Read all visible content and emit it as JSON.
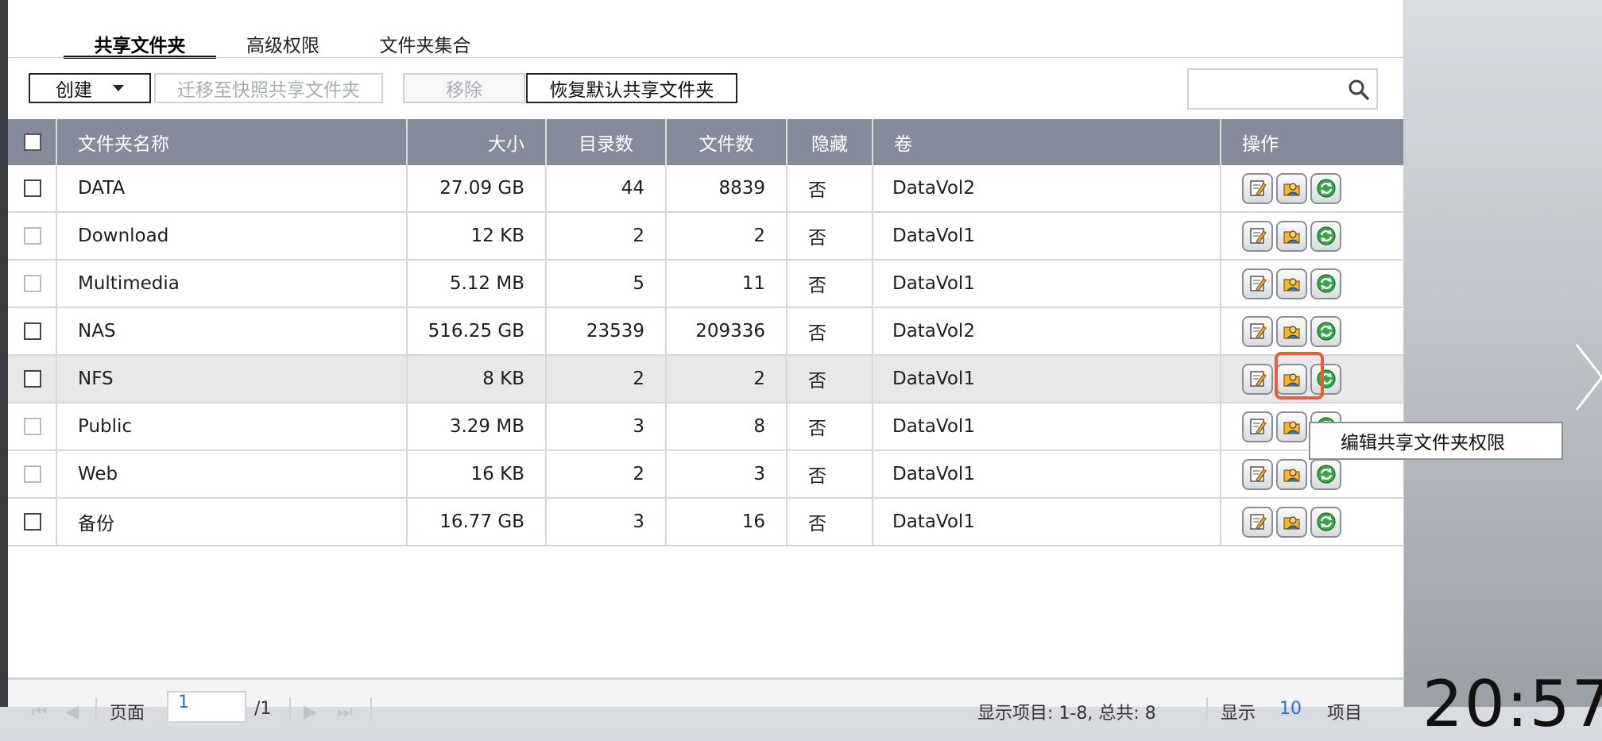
{
  "tabs": [
    {
      "label": "共享文件夹",
      "active": true
    },
    {
      "label": "高级权限",
      "active": false
    },
    {
      "label": "文件夹集合",
      "active": false
    }
  ],
  "toolbar": {
    "create": "创建",
    "migrate": "迁移至快照共享文件夹",
    "remove": "移除",
    "restore": "恢复默认共享文件夹"
  },
  "search": {
    "placeholder": ""
  },
  "table": {
    "headers": {
      "name": "文件夹名称",
      "size": "大小",
      "dirs": "目录数",
      "files": "文件数",
      "hidden": "隐藏",
      "volume": "卷",
      "actions": "操作"
    },
    "rows": [
      {
        "name": "DATA",
        "size": "27.09 GB",
        "dirs": "44",
        "files": "8839",
        "hidden": "否",
        "volume": "DataVol2"
      },
      {
        "name": "Download",
        "size": "12 KB",
        "dirs": "2",
        "files": "2",
        "hidden": "否",
        "volume": "DataVol1"
      },
      {
        "name": "Multimedia",
        "size": "5.12 MB",
        "dirs": "5",
        "files": "11",
        "hidden": "否",
        "volume": "DataVol1"
      },
      {
        "name": "NAS",
        "size": "516.25 GB",
        "dirs": "23539",
        "files": "209336",
        "hidden": "否",
        "volume": "DataVol2"
      },
      {
        "name": "NFS",
        "size": "8 KB",
        "dirs": "2",
        "files": "2",
        "hidden": "否",
        "volume": "DataVol1"
      },
      {
        "name": "Public",
        "size": "3.29 MB",
        "dirs": "3",
        "files": "8",
        "hidden": "否",
        "volume": "DataVol1"
      },
      {
        "name": "Web",
        "size": "16 KB",
        "dirs": "2",
        "files": "3",
        "hidden": "否",
        "volume": "DataVol1"
      },
      {
        "name": "备份",
        "size": "16.77 GB",
        "dirs": "3",
        "files": "16",
        "hidden": "否",
        "volume": "DataVol1"
      }
    ]
  },
  "tooltip": "编辑共享文件夹权限",
  "footer": {
    "page_label": "页面",
    "page_value": "1",
    "page_total": "/1",
    "display_items": "显示项目: 1-8, 总共: 8",
    "display_label": "显示",
    "per_page": "10",
    "items_label": "项目"
  },
  "clock": "20:57",
  "icons": {
    "edit": "edit-properties-icon",
    "permission": "edit-permissions-icon",
    "refresh": "refresh-icon",
    "search": "search-icon"
  }
}
